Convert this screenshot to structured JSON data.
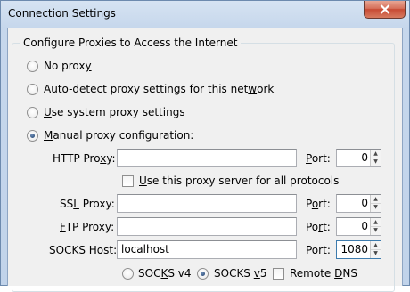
{
  "window": {
    "title": "Connection Settings"
  },
  "group": {
    "label": "Configure Proxies to Access the Internet"
  },
  "proxy_options": [
    {
      "pre": "No prox",
      "key": "y",
      "post": "",
      "checked": false
    },
    {
      "pre": "Auto-detect proxy settings for this net",
      "key": "w",
      "post": "ork",
      "checked": false
    },
    {
      "pre": "",
      "key": "U",
      "post": "se system proxy settings",
      "checked": false
    },
    {
      "pre": "",
      "key": "M",
      "post": "anual proxy configuration:",
      "checked": true
    }
  ],
  "http": {
    "pre": "HTTP Pro",
    "key": "x",
    "post": "y:",
    "value": "",
    "port_label_pre": "",
    "port_key": "P",
    "port_label_post": "ort:",
    "port": "0"
  },
  "same_proxy": {
    "pre": "",
    "key": "U",
    "post": "se this proxy server for all protocols",
    "checked": false
  },
  "ssl": {
    "pre": "SS",
    "key": "L",
    "post": " Proxy:",
    "value": "",
    "port_label_pre": "P",
    "port_key": "o",
    "port_label_post": "rt:",
    "port": "0"
  },
  "ftp": {
    "pre": "",
    "key": "F",
    "post": "TP Proxy:",
    "value": "",
    "port_label_pre": "Po",
    "port_key": "r",
    "port_label_post": "t:",
    "port": "0"
  },
  "socks": {
    "pre": "SO",
    "key": "C",
    "post": "KS Host:",
    "value": "localhost",
    "port_label_pre": "Por",
    "port_key": "t",
    "port_label_post": ":",
    "port": "1080"
  },
  "socks_versions": [
    {
      "pre": "SOC",
      "key": "K",
      "post": "S v4",
      "checked": false
    },
    {
      "pre": "SOCKS ",
      "key": "v",
      "post": "5",
      "checked": true
    }
  ],
  "remote_dns": {
    "pre": "Remote ",
    "key": "D",
    "post": "NS",
    "checked": false
  }
}
